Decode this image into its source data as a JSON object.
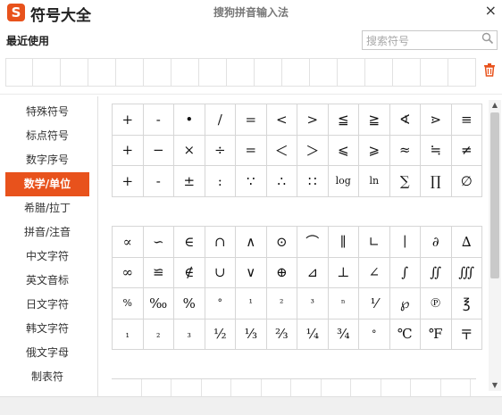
{
  "header": {
    "logo_letter": "S",
    "app_title": "符号大全",
    "window_title": "搜狗拼音输入法",
    "close_glyph": "×"
  },
  "recent": {
    "label": "最近使用",
    "search_placeholder": "搜索符号"
  },
  "sidebar": {
    "items": [
      {
        "label": "特殊符号"
      },
      {
        "label": "标点符号"
      },
      {
        "label": "数字序号"
      },
      {
        "label": "数学/单位",
        "active": true
      },
      {
        "label": "希腊/拉丁"
      },
      {
        "label": "拼音/注音"
      },
      {
        "label": "中文字符"
      },
      {
        "label": "英文音标"
      },
      {
        "label": "日文字符"
      },
      {
        "label": "韩文字符"
      },
      {
        "label": "俄文字母"
      },
      {
        "label": "制表符"
      }
    ]
  },
  "symbols": {
    "group1": [
      [
        "+",
        "-",
        "•",
        "/",
        "=",
        "<",
        ">",
        "≦",
        "≧",
        "∢",
        "⋗",
        "≡"
      ],
      [
        "+",
        "−",
        "×",
        "÷",
        "=",
        "＜",
        "＞",
        "⩽",
        "⩾",
        "≈",
        "≒",
        "≠"
      ],
      [
        "+",
        "-",
        "±",
        ":",
        "∵",
        "∴",
        "∷",
        "log",
        "ln",
        "∑",
        "∏",
        "∅"
      ]
    ],
    "group2": [
      [
        "∝",
        "∽",
        "∈",
        "∩",
        "∧",
        "⊙",
        "⌒",
        "∥",
        "∟",
        "∣",
        "∂",
        "∆"
      ],
      [
        "∞",
        "≌",
        "∉",
        "∪",
        "∨",
        "⊕",
        "⊿",
        "⊥",
        "∠",
        "∫",
        "∬",
        "∭"
      ],
      [
        "%",
        "‰",
        "%",
        "°",
        "¹",
        "²",
        "³",
        "ⁿ",
        "⅟",
        "℘",
        "℗",
        "℥"
      ],
      [
        "₁",
        "₂",
        "₃",
        "½",
        "⅓",
        "⅔",
        "¼",
        "¾",
        "°",
        "℃",
        "℉",
        "〒"
      ]
    ]
  },
  "scrollbar": {
    "up_glyph": "▲",
    "down_glyph": "▼"
  }
}
